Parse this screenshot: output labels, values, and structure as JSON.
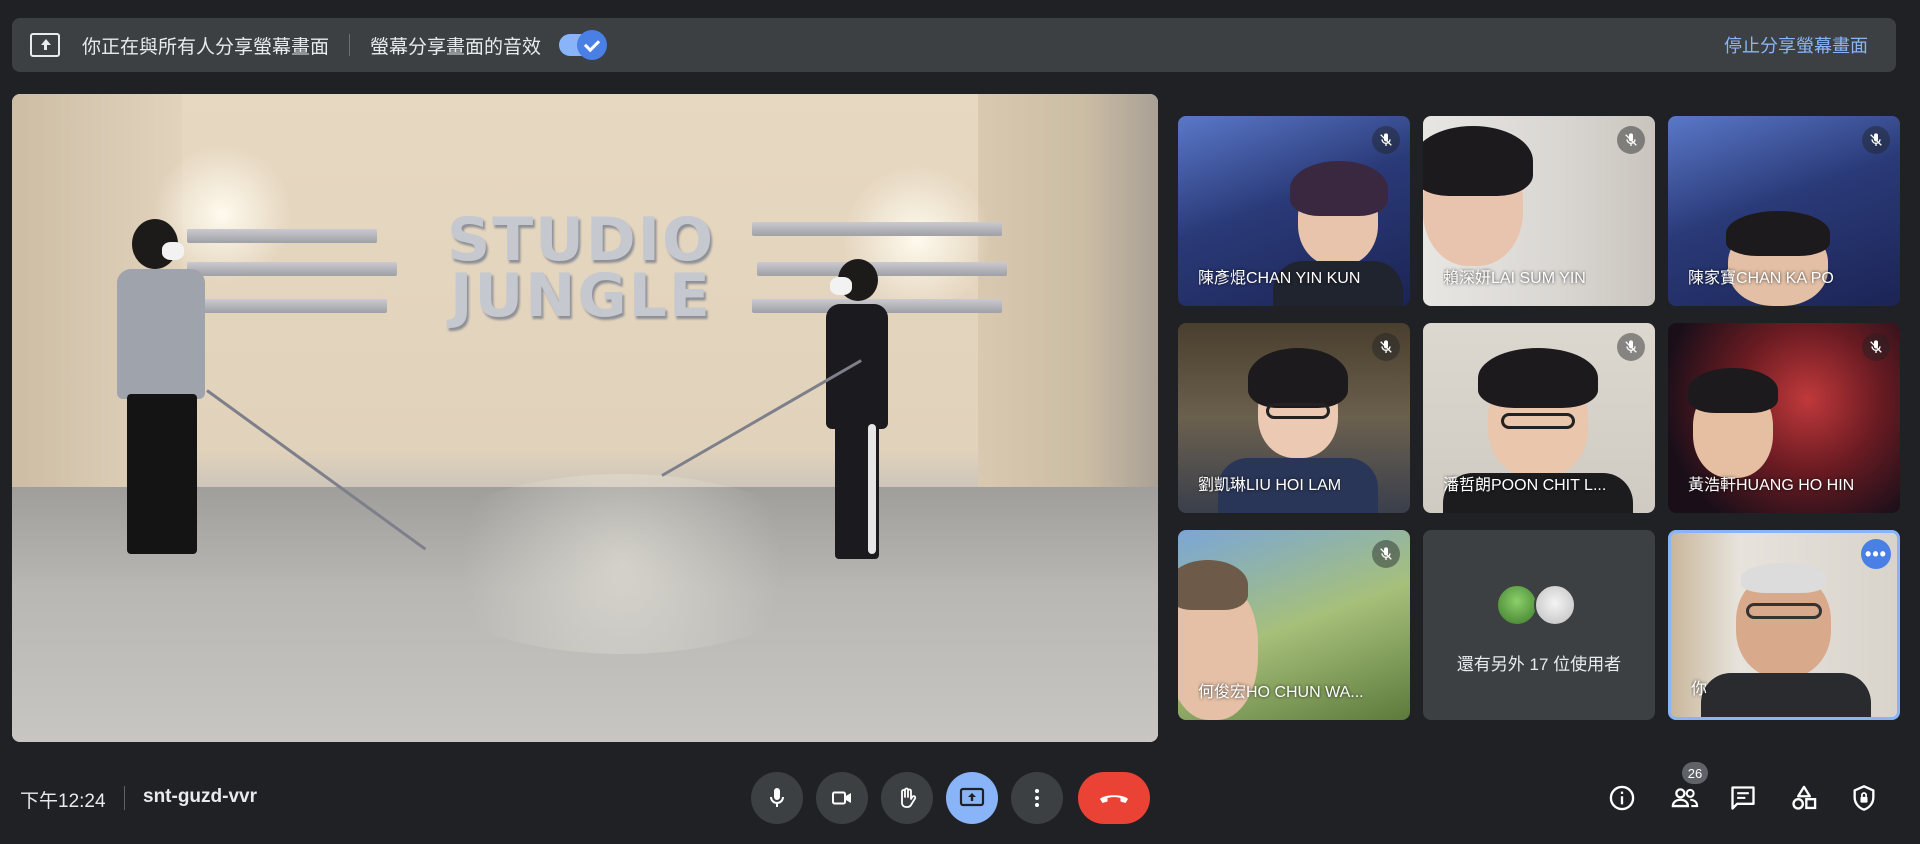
{
  "banner": {
    "sharing_text": "你正在與所有人分享螢幕畫面",
    "audio_text": "螢幕分享畫面的音效",
    "audio_enabled": true,
    "stop_label": "停止分享螢幕畫面"
  },
  "presentation": {
    "logo_line1": "STUDIO",
    "logo_line2": "JUNGLE"
  },
  "participants": [
    {
      "name": "陳彥焜CHAN YIN KUN",
      "muted": true
    },
    {
      "name": "賴深妍LAI SUM YIN",
      "muted": true
    },
    {
      "name": "陳家寶CHAN KA PO",
      "muted": true
    },
    {
      "name": "劉凱琳LIU HOI LAM",
      "muted": true
    },
    {
      "name": "潘哲朗POON CHIT L...",
      "muted": true
    },
    {
      "name": "黃浩軒HUANG HO HIN",
      "muted": true
    },
    {
      "name": "何俊宏HO CHUN WA...",
      "muted": true
    }
  ],
  "more_participants": {
    "text": "還有另外 17 位使用者"
  },
  "self_tile": {
    "name": "你"
  },
  "bottom_bar": {
    "time": "下午12:24",
    "meeting_code": "snt-guzd-vvr",
    "participant_count": "26"
  },
  "colors": {
    "background": "#202124",
    "surface": "#3c4043",
    "accent": "#8ab4f8",
    "hangup": "#ea4335"
  }
}
